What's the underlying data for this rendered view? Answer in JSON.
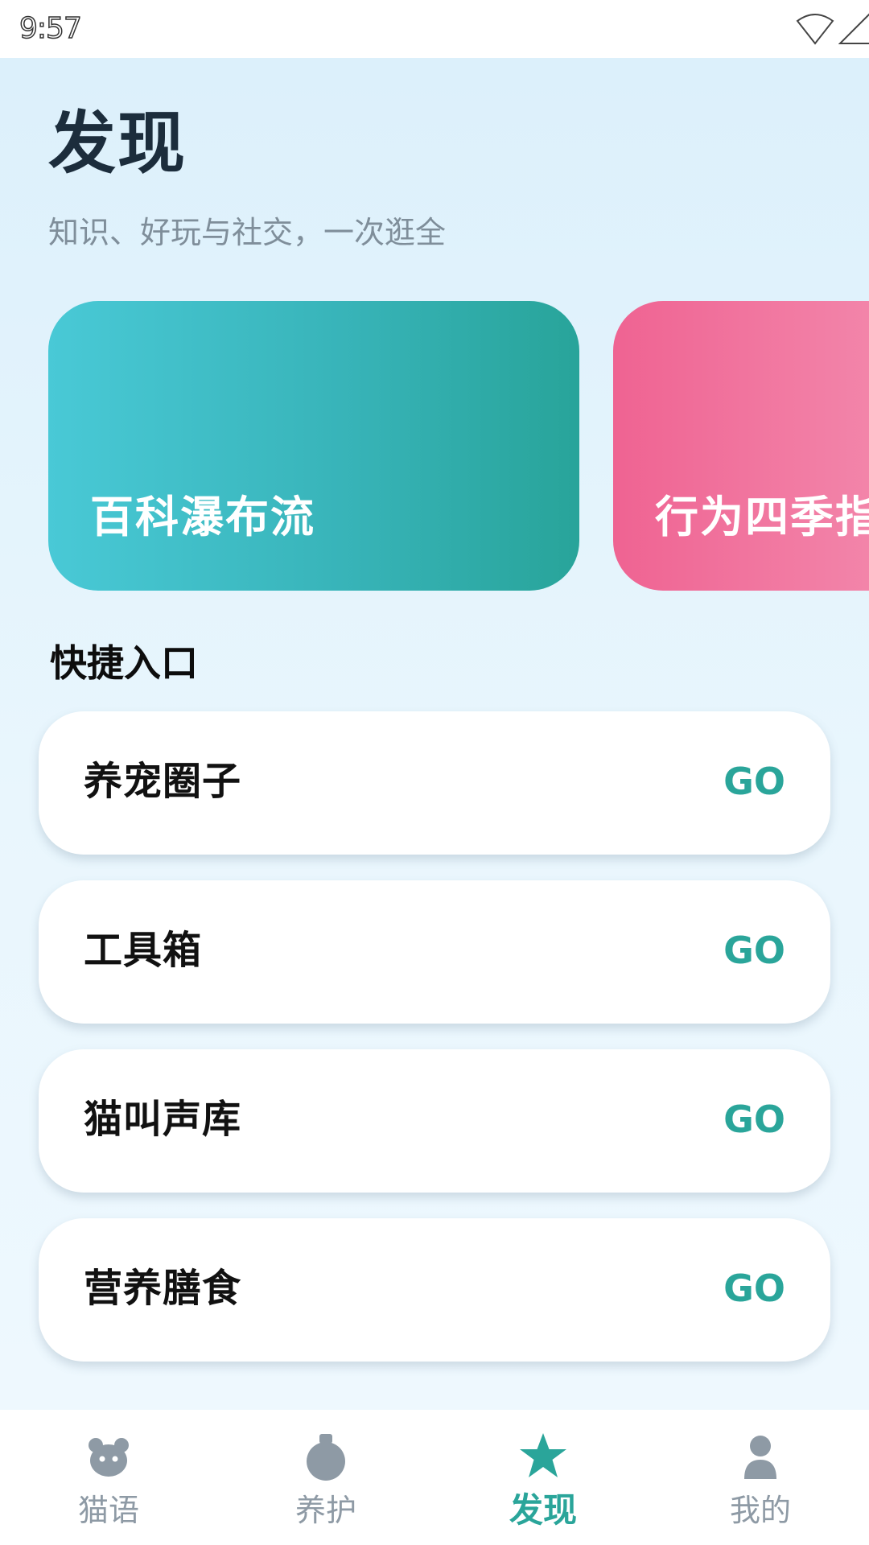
{
  "status_bar": {
    "time": "9:57",
    "icons": [
      "wifi-icon",
      "signal-icon",
      "battery-charging-icon"
    ]
  },
  "header": {
    "title": "发现",
    "subtitle": "知识、好玩与社交，一次逛全"
  },
  "banners": [
    {
      "label": "百科瀑布流",
      "icon": "none",
      "colors": [
        "#49c9d6",
        "#28a49a"
      ]
    },
    {
      "label": "行为四季指",
      "icon": "none",
      "colors": [
        "#ef6392",
        "#f48fb1"
      ]
    }
  ],
  "quick_entries": {
    "title": "快捷入口",
    "go_color": "#2aa59a",
    "items": [
      {
        "label": "养宠圈子",
        "action": "GO"
      },
      {
        "label": "工具箱",
        "action": "GO"
      },
      {
        "label": "猫叫声库",
        "action": "GO"
      },
      {
        "label": "营养膳食",
        "action": "GO"
      }
    ]
  },
  "bottom_nav": {
    "active_color": "#2aa59a",
    "inactive_color": "#8e9aa5",
    "items": [
      {
        "label": "猫语",
        "icon": "cat-face-icon",
        "active": false
      },
      {
        "label": "养护",
        "icon": "bottle-icon",
        "active": false
      },
      {
        "label": "发现",
        "icon": "star-icon",
        "active": true
      },
      {
        "label": "我的",
        "icon": "person-icon",
        "active": false
      }
    ]
  }
}
